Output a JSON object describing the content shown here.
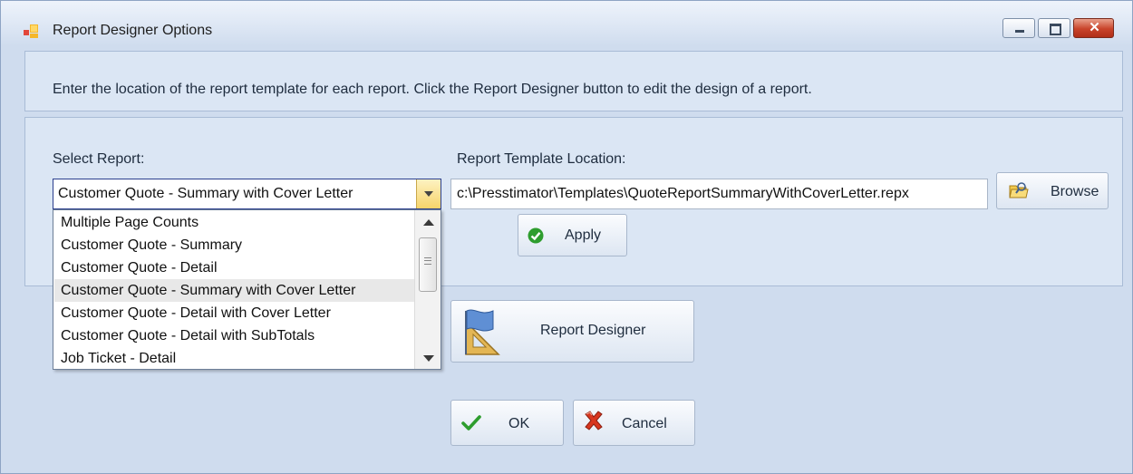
{
  "window": {
    "title": "Report Designer Options",
    "controls": [
      "minimize",
      "maximize",
      "close"
    ]
  },
  "instructions": "Enter the location of the report template for each report.  Click the Report Designer button to edit the design of a report.",
  "select_report": {
    "label": "Select Report:",
    "value": "Customer Quote - Summary with Cover Letter",
    "options": [
      "Multiple Page Counts",
      "Customer Quote - Summary",
      "Customer Quote - Detail",
      "Customer Quote - Summary with Cover Letter",
      "Customer Quote - Detail with Cover Letter",
      "Customer Quote - Detail with SubTotals",
      "Job Ticket - Detail"
    ],
    "highlighted_index": 3
  },
  "template_location": {
    "label": "Report Template Location:",
    "value": "c:\\Presstimator\\Templates\\QuoteReportSummaryWithCoverLetter.repx"
  },
  "buttons": {
    "browse": "Browse",
    "apply": "Apply",
    "report_designer": "Report Designer",
    "ok": "OK",
    "cancel": "Cancel"
  },
  "colors": {
    "window_bg": "#cfdcee",
    "panel_bg": "#dbe6f4",
    "combo_border": "#2b3f8e",
    "dropdown_button": "#f7d46a",
    "apply_icon": "#2e9d2e",
    "ok_icon": "#2e9d2e",
    "cancel_icon": "#d8361e"
  }
}
